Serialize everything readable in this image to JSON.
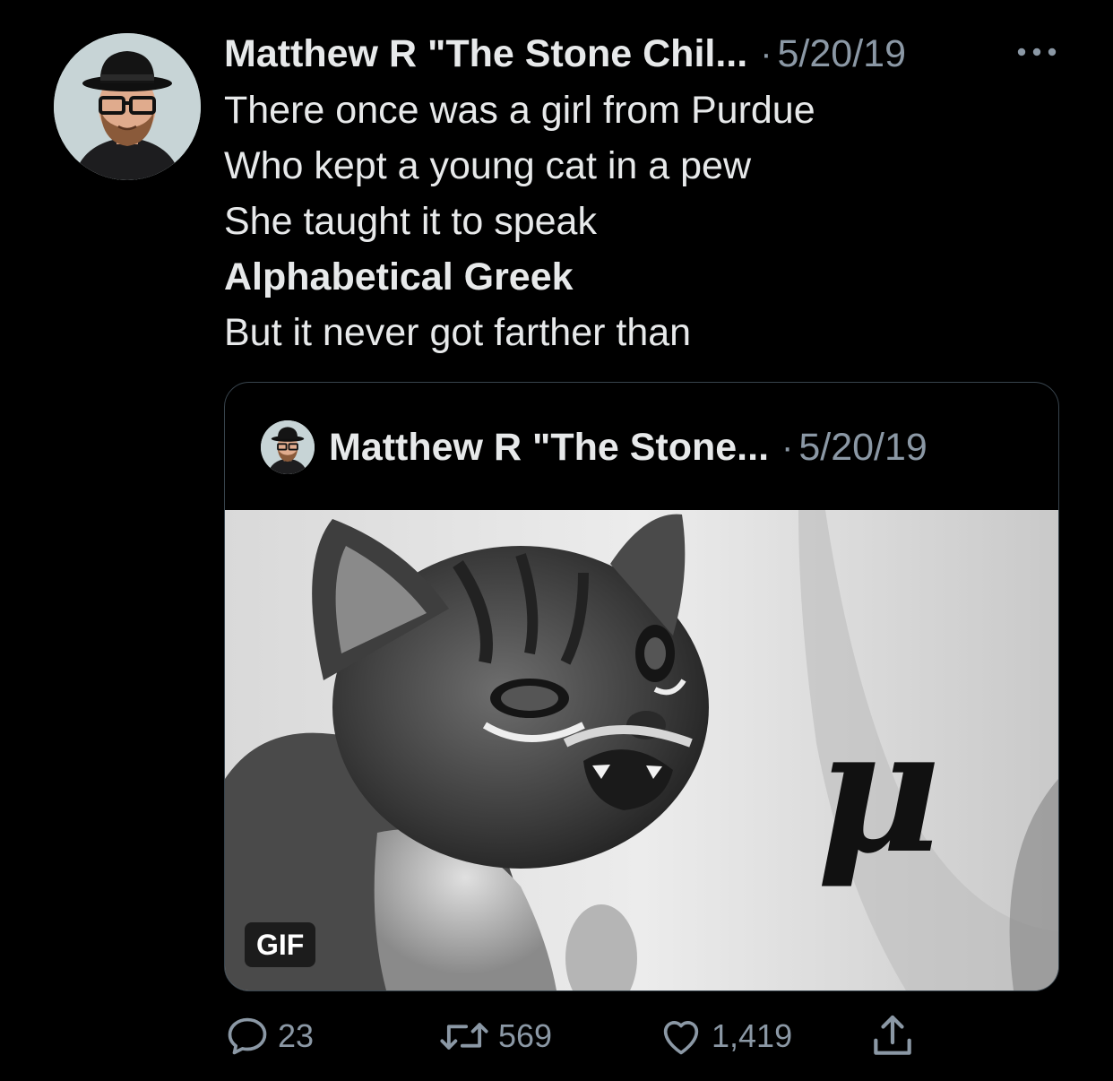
{
  "tweet": {
    "author_name": "Matthew R \"The Stone Chil...",
    "separator": "·",
    "date": "5/20/19",
    "lines": [
      "There once was a girl from Purdue",
      "Who kept a young cat in a pew",
      "She taught it to speak",
      "Alphabetical Greek",
      "But it never got farther than"
    ],
    "avatar_icon": "illustrated-man-hat-glasses-avatar",
    "more_icon": "more-horizontal-icon"
  },
  "quote": {
    "author_name": "Matthew R \"The Stone...",
    "separator": "·",
    "date": "5/20/19",
    "media_badge": "GIF",
    "media_glyph": "μ"
  },
  "actions": {
    "reply_count": "23",
    "retweet_count": "569",
    "like_count": "1,419"
  },
  "colors": {
    "background": "#000000",
    "text_primary": "#e7e9ea",
    "text_secondary": "#8b98a5",
    "border": "#38444d"
  }
}
